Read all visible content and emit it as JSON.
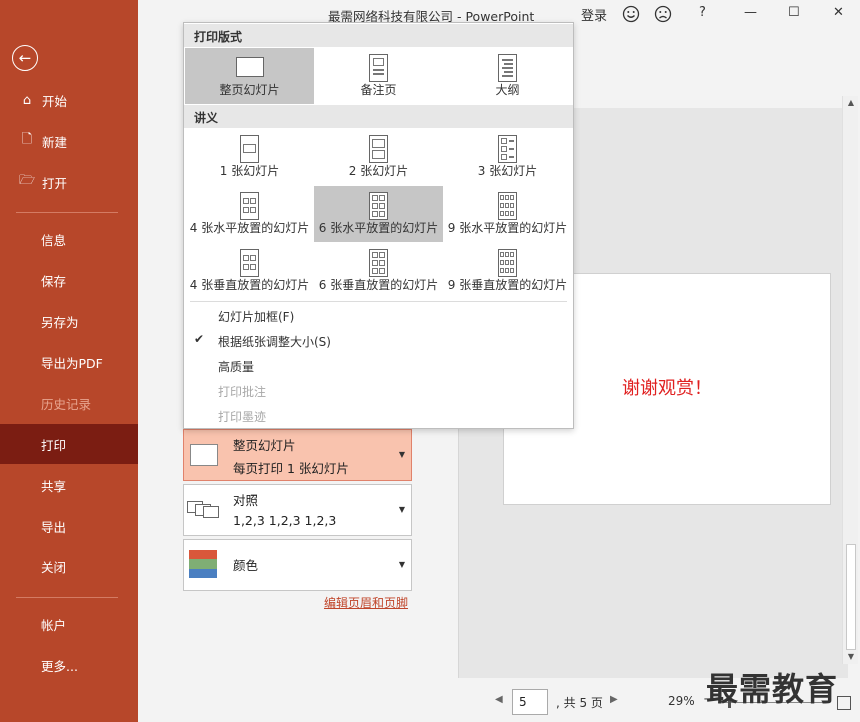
{
  "window": {
    "title": "最需网络科技有限公司  -  PowerPoint",
    "signin": "登录",
    "help": "?",
    "minimize": "—",
    "maximize": "☐",
    "close": "✕"
  },
  "sidebar": {
    "back_icon": "←",
    "items": [
      {
        "label": "开始",
        "icon": "⌂"
      },
      {
        "label": "新建",
        "icon": "🗋"
      },
      {
        "label": "打开",
        "icon": "🗁"
      },
      {
        "label": "信息"
      },
      {
        "label": "保存"
      },
      {
        "label": "另存为"
      },
      {
        "label": "导出为PDF"
      },
      {
        "label": "历史记录"
      },
      {
        "label": "打印"
      },
      {
        "label": "共享"
      },
      {
        "label": "导出"
      },
      {
        "label": "关闭"
      },
      {
        "label": "帐户"
      },
      {
        "label": "更多..."
      }
    ]
  },
  "dropdown": {
    "section_layout": "打印版式",
    "layout_options": [
      "整页幻灯片",
      "备注页",
      "大纲"
    ],
    "section_handouts": "讲义",
    "handout_options": [
      "1 张幻灯片",
      "2 张幻灯片",
      "3 张幻灯片",
      "4 张水平放置的幻灯片",
      "6 张水平放置的幻灯片",
      "9 张水平放置的幻灯片",
      "4 张垂直放置的幻灯片",
      "6 张垂直放置的幻灯片",
      "9 张垂直放置的幻灯片"
    ],
    "menu": [
      "幻灯片加框(F)",
      "根据纸张调整大小(S)",
      "高质量",
      "打印批注",
      "打印墨迹"
    ],
    "check_mark": "✔"
  },
  "settings": {
    "layout_box": {
      "line1": "整页幻灯片",
      "line2": "每页打印 1 张幻灯片"
    },
    "collate_box": {
      "line1": "对照",
      "line2": "1,2,3    1,2,3    1,2,3"
    },
    "color_box": {
      "line1": "颜色"
    },
    "edit_link": "编辑页眉和页脚",
    "dropdown_arrow": "▼"
  },
  "preview": {
    "slide_text": "谢谢观赏！"
  },
  "pager": {
    "current_page": "5",
    "total": ", 共 5 页",
    "zoom": "29%",
    "zoom_minus": "−",
    "prev": "◀",
    "next": "▶"
  },
  "watermark": "最需教育",
  "colors": {
    "sidebar": "#b7472a",
    "sidebar_active": "#7b1d12",
    "highlight": "#f9c3ae"
  }
}
